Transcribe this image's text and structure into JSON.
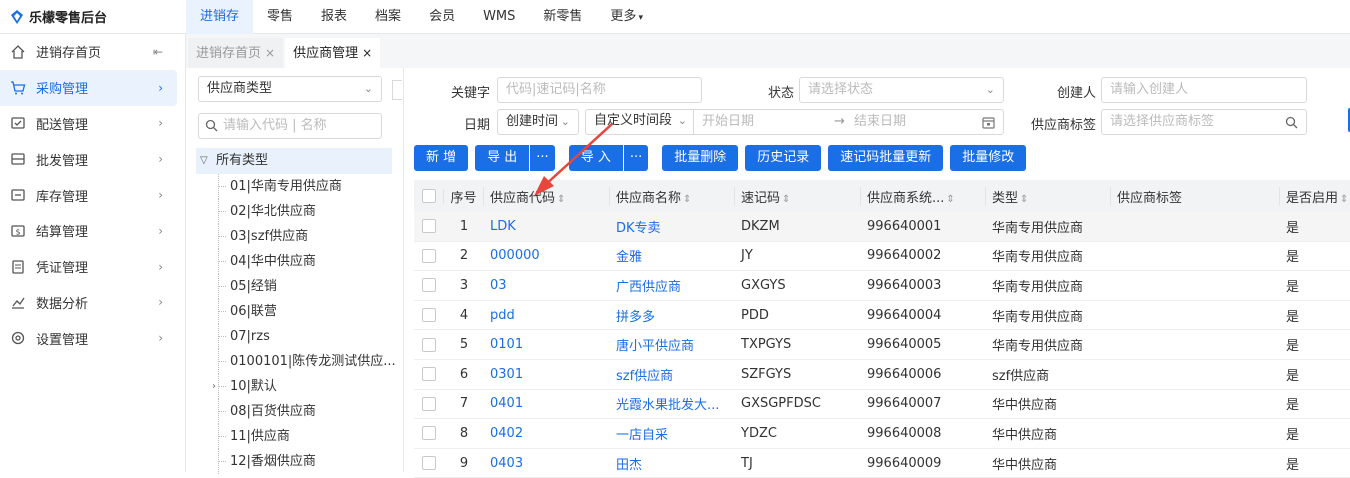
{
  "app": {
    "brand": "乐檬零售后台"
  },
  "topnav": [
    {
      "label": "进销存",
      "active": true
    },
    {
      "label": "零售"
    },
    {
      "label": "报表"
    },
    {
      "label": "档案"
    },
    {
      "label": "会员"
    },
    {
      "label": "WMS"
    },
    {
      "label": "新零售"
    },
    {
      "label": "更多"
    }
  ],
  "sidebar": {
    "items": [
      {
        "label": "进销存首页",
        "icon": "home-icon"
      },
      {
        "label": "采购管理",
        "icon": "cart-icon",
        "active": true
      },
      {
        "label": "配送管理",
        "icon": "delivery-icon"
      },
      {
        "label": "批发管理",
        "icon": "wholesale-icon"
      },
      {
        "label": "库存管理",
        "icon": "inventory-icon"
      },
      {
        "label": "结算管理",
        "icon": "settlement-icon"
      },
      {
        "label": "凭证管理",
        "icon": "voucher-icon"
      },
      {
        "label": "数据分析",
        "icon": "chart-icon"
      },
      {
        "label": "设置管理",
        "icon": "settings-icon"
      }
    ]
  },
  "tabs": [
    {
      "label": "进销存首页",
      "active": false
    },
    {
      "label": "供应商管理",
      "active": true
    }
  ],
  "tree": {
    "select_value": "供应商类型",
    "search_placeholder": "请输入代码 | 名称",
    "root": "所有类型",
    "nodes": [
      "01|华南专用供应商",
      "02|华北供应商",
      "03|szf供应商",
      "04|华中供应商",
      "05|经销",
      "06|联营",
      "07|rzs",
      "0100101|陈传龙测试供应...",
      "10|默认",
      "08|百货供应商",
      "11|供应商",
      "12|香烟供应商"
    ]
  },
  "filters": {
    "keyword_label": "关键字",
    "keyword_placeholder": "代码|速记码|名称",
    "status_label": "状态",
    "status_placeholder": "请选择状态",
    "creator_label": "创建人",
    "creator_placeholder": "请输入创建人",
    "date_label": "日期",
    "date_type_value": "创建时间",
    "time_range_value": "自定义时间段",
    "start_placeholder": "开始日期",
    "range_arrow": "→",
    "end_placeholder": "结束日期",
    "tag_label": "供应商标签",
    "tag_placeholder": "请选择供应商标签"
  },
  "buttons": {
    "add": "新 增",
    "export": "导 出",
    "more1": "···",
    "import": "导 入",
    "more2": "···",
    "batch_delete": "批量删除",
    "history": "历史记录",
    "batch_quick_update": "速记码批量更新",
    "batch_edit": "批量修改"
  },
  "table": {
    "headers": {
      "no": "序号",
      "code": "供应商代码",
      "name": "供应商名称",
      "quick": "速记码",
      "sys": "供应商系统...",
      "type": "类型",
      "tag": "供应商标签",
      "enabled": "是否启用"
    },
    "rows": [
      {
        "no": "1",
        "code": "LDK",
        "name": "DK专卖",
        "quick": "DKZM",
        "sys": "996640001",
        "type": "华南专用供应商",
        "enabled": "是"
      },
      {
        "no": "2",
        "code": "000000",
        "name": "金雅",
        "quick": "JY",
        "sys": "996640002",
        "type": "华南专用供应商",
        "enabled": "是"
      },
      {
        "no": "3",
        "code": "03",
        "name": "广西供应商",
        "quick": "GXGYS",
        "sys": "996640003",
        "type": "华南专用供应商",
        "enabled": "是"
      },
      {
        "no": "4",
        "code": "pdd",
        "name": "拼多多",
        "quick": "PDD",
        "sys": "996640004",
        "type": "华南专用供应商",
        "enabled": "是"
      },
      {
        "no": "5",
        "code": "0101",
        "name": "唐小平供应商",
        "quick": "TXPGYS",
        "sys": "996640005",
        "type": "华南专用供应商",
        "enabled": "是"
      },
      {
        "no": "6",
        "code": "0301",
        "name": "szf供应商",
        "quick": "SZFGYS",
        "sys": "996640006",
        "type": "szf供应商",
        "enabled": "是"
      },
      {
        "no": "7",
        "code": "0401",
        "name": "光霞水果批发大...",
        "quick": "GXSGPFDSC",
        "sys": "996640007",
        "type": "华中供应商",
        "enabled": "是"
      },
      {
        "no": "8",
        "code": "0402",
        "name": "一店自采",
        "quick": "YDZC",
        "sys": "996640008",
        "type": "华中供应商",
        "enabled": "是"
      },
      {
        "no": "9",
        "code": "0403",
        "name": "田杰",
        "quick": "TJ",
        "sys": "996640009",
        "type": "华中供应商",
        "enabled": "是"
      }
    ]
  },
  "colors": {
    "accent": "#1a6ee6",
    "annotation_arrow": "#e8453c"
  }
}
